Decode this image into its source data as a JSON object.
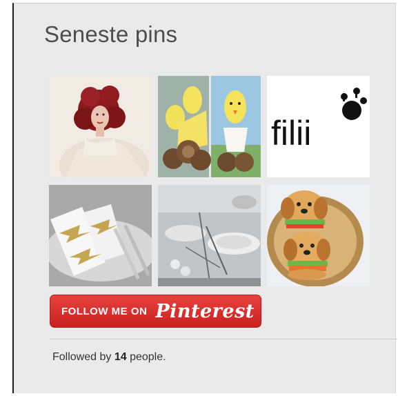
{
  "widget": {
    "title": "Seneste pins",
    "pins": [
      {
        "icon": "pin-image-red-haired-woman"
      },
      {
        "icon": "pin-image-easter-chick-crafts"
      },
      {
        "icon": "pin-image-filii-logo",
        "logo_text": "filii"
      },
      {
        "icon": "pin-image-gold-napkins"
      },
      {
        "icon": "pin-image-table-setting"
      },
      {
        "icon": "pin-image-puppy-burgers"
      }
    ],
    "follow_button": {
      "prefix": "FOLLOW ME ON",
      "brand": "Pinterest"
    },
    "followers": {
      "prefix": "Followed by",
      "count": "14",
      "suffix": "people."
    }
  },
  "colors": {
    "background": "#ebeaea",
    "button_red": "#d72f2c",
    "title_text": "#4d4d4d"
  }
}
